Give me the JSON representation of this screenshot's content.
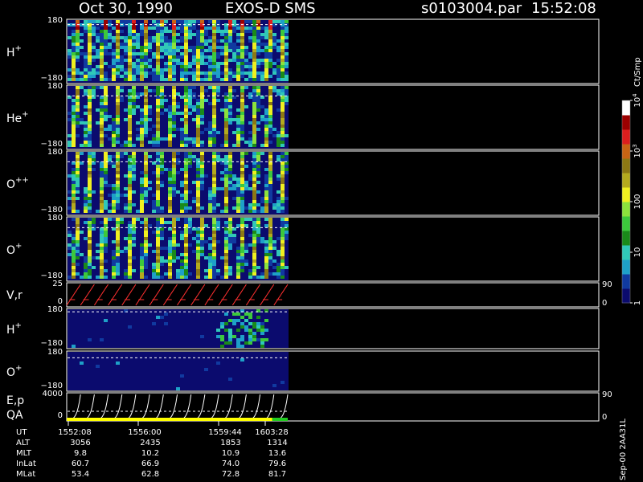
{
  "header": {
    "date": "Oct 30, 1990",
    "mission": "EXOS-D SMS",
    "file": "s0103004.par",
    "time": "15:52:08"
  },
  "colorbar": {
    "unit": "Ct/Smp",
    "ticks": [
      {
        "label": "1",
        "value": 1
      },
      {
        "label": "10",
        "value": 10
      },
      {
        "label": "100",
        "value": 100
      },
      {
        "label": "10^3",
        "value": 1000
      },
      {
        "label": "10^4",
        "value": 10000
      }
    ],
    "colors": [
      "#0b0b6e",
      "#103aa0",
      "#1ea0c8",
      "#30c8b8",
      "#1a8a1a",
      "#3cc83c",
      "#8ce23c",
      "#f0f020",
      "#b4aa1e",
      "#8c7814",
      "#c86414",
      "#dc1e1e",
      "#9c0000",
      "#ffffff"
    ]
  },
  "footer": {
    "side_label": "Sep-00 2AA31L",
    "rows": [
      {
        "label": "UT",
        "values": [
          "1552:08",
          "1556:00",
          "1559:44",
          "1603:28"
        ]
      },
      {
        "label": "ALT",
        "values": [
          "3056",
          "2435",
          "1853",
          "1314"
        ]
      },
      {
        "label": "MLT",
        "values": [
          "9.8",
          "10.2",
          "10.9",
          "13.6"
        ]
      },
      {
        "label": "InLat",
        "values": [
          "60.7",
          "66.9",
          "74.0",
          "79.6"
        ]
      },
      {
        "label": "MLat",
        "values": [
          "53.4",
          "62.8",
          "72.8",
          "81.7"
        ]
      }
    ]
  },
  "chart_data": [
    {
      "type": "heatmap",
      "species": "H",
      "charge": "+",
      "y_top": "180",
      "y_bottom": "−180",
      "ylim": [
        -180,
        180
      ],
      "sweeps": 16,
      "reference_y": 150
    },
    {
      "type": "heatmap",
      "species": "He",
      "charge": "+",
      "y_top": "180",
      "y_bottom": "−180",
      "ylim": [
        -180,
        180
      ],
      "sweeps": 16,
      "reference_y": 120
    },
    {
      "type": "heatmap",
      "species": "O",
      "charge": "++",
      "y_top": "180",
      "y_bottom": "−180",
      "ylim": [
        -180,
        180
      ],
      "sweeps": 16,
      "reference_y": 120
    },
    {
      "type": "heatmap",
      "species": "O",
      "charge": "+",
      "y_top": "180",
      "y_bottom": "−180",
      "ylim": [
        -180,
        180
      ],
      "sweeps": 16,
      "reference_y": 120
    },
    {
      "type": "line",
      "label": "V,r",
      "y_top": "25",
      "y_bottom": "0",
      "ylim": [
        0,
        25
      ],
      "right_top": "90",
      "right_bottom": "0",
      "sweeps": 16
    },
    {
      "type": "heatmap",
      "species": "H",
      "charge": "+",
      "y_top": "180",
      "y_bottom": "−180",
      "ylim": [
        -180,
        180
      ],
      "reference_y": 150
    },
    {
      "type": "heatmap",
      "species": "O",
      "charge": "+",
      "y_top": "180",
      "y_bottom": "−180",
      "ylim": [
        -180,
        180
      ],
      "reference_y": 120
    },
    {
      "type": "line",
      "label": "E,p",
      "label2": "QA",
      "y_top": "4000",
      "y_bottom": "0",
      "ylim": [
        0,
        4000
      ],
      "right_top": "90",
      "right_bottom": "0",
      "sweeps": 16,
      "qa_flags": [
        "#ffff00",
        "#22cc22"
      ]
    }
  ]
}
